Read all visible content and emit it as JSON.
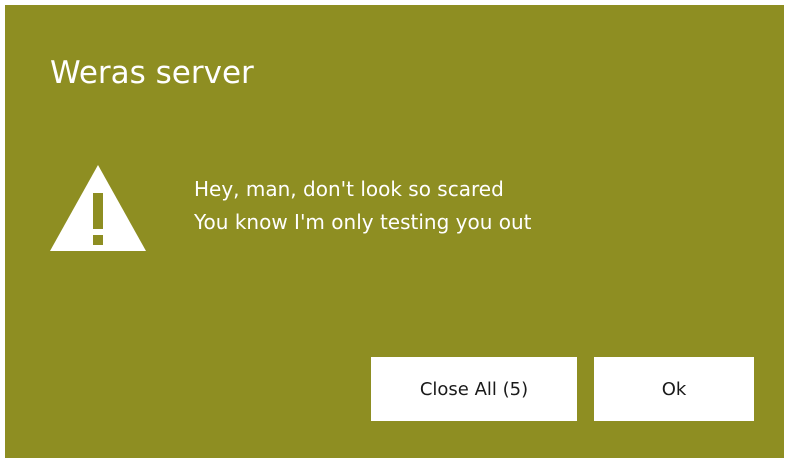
{
  "dialog": {
    "title": "Weras server",
    "icon": "warning-triangle-icon",
    "message_lines": [
      "Hey, man, don't look so scared",
      "You know I'm only testing you out"
    ],
    "buttons": {
      "close_all_label": "Close All (5)",
      "ok_label": "Ok"
    },
    "colors": {
      "background": "#8e8e22",
      "text": "#ffffff",
      "button_background": "#ffffff",
      "button_text": "#1a1a1a"
    }
  }
}
